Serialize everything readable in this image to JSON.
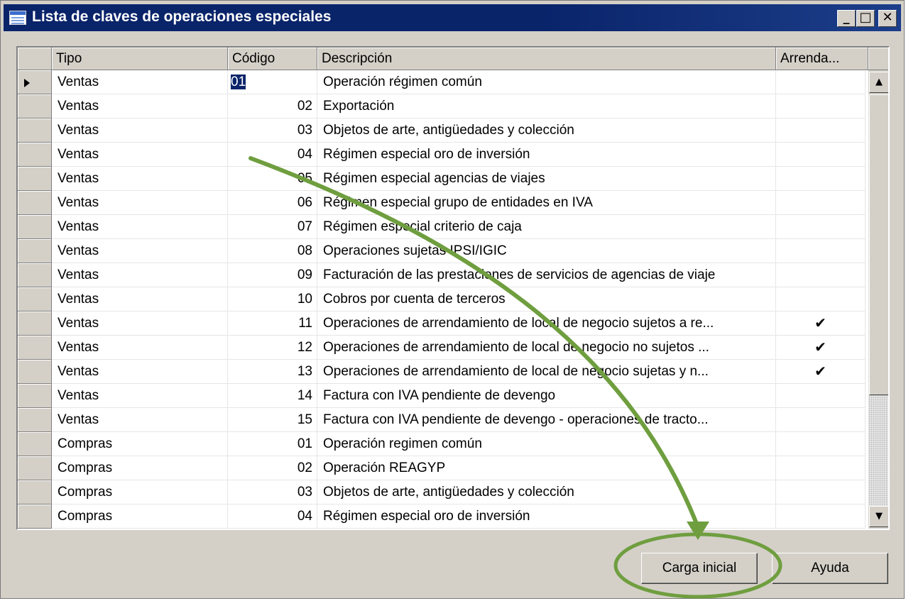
{
  "window": {
    "title": "Lista de claves de operaciones especiales",
    "controls": {
      "minimize": "_",
      "maximize": "□",
      "close": "✕"
    }
  },
  "grid": {
    "columns": [
      {
        "key": "tipo",
        "label": "Tipo"
      },
      {
        "key": "codigo",
        "label": "Código"
      },
      {
        "key": "descripcion",
        "label": "Descripción"
      },
      {
        "key": "arrendamiento",
        "label": "Arrenda..."
      }
    ],
    "rows": [
      {
        "tipo": "Ventas",
        "codigo": "01",
        "descripcion": "Operación régimen común",
        "arrendamiento": ""
      },
      {
        "tipo": "Ventas",
        "codigo": "02",
        "descripcion": "Exportación",
        "arrendamiento": ""
      },
      {
        "tipo": "Ventas",
        "codigo": "03",
        "descripcion": "Objetos de arte, antigüedades y colección",
        "arrendamiento": ""
      },
      {
        "tipo": "Ventas",
        "codigo": "04",
        "descripcion": "Régimen especial oro de inversión",
        "arrendamiento": ""
      },
      {
        "tipo": "Ventas",
        "codigo": "05",
        "descripcion": "Régimen especial agencias de viajes",
        "arrendamiento": ""
      },
      {
        "tipo": "Ventas",
        "codigo": "06",
        "descripcion": "Régimen especial grupo de entidades en IVA",
        "arrendamiento": ""
      },
      {
        "tipo": "Ventas",
        "codigo": "07",
        "descripcion": "Régimen especial criterio de caja",
        "arrendamiento": ""
      },
      {
        "tipo": "Ventas",
        "codigo": "08",
        "descripcion": "Operaciones sujetas IPSI/IGIC",
        "arrendamiento": ""
      },
      {
        "tipo": "Ventas",
        "codigo": "09",
        "descripcion": "Facturación de las prestaciones de servicios de agencias de viaje",
        "arrendamiento": ""
      },
      {
        "tipo": "Ventas",
        "codigo": "10",
        "descripcion": "Cobros por cuenta de terceros",
        "arrendamiento": ""
      },
      {
        "tipo": "Ventas",
        "codigo": "11",
        "descripcion": "Operaciones de arrendamiento de local de negocio sujetos a re...",
        "arrendamiento": "✔"
      },
      {
        "tipo": "Ventas",
        "codigo": "12",
        "descripcion": "Operaciones de arrendamiento de local de negocio no sujetos ...",
        "arrendamiento": "✔"
      },
      {
        "tipo": "Ventas",
        "codigo": "13",
        "descripcion": "Operaciones de arrendamiento de local de negocio sujetas y n...",
        "arrendamiento": "✔"
      },
      {
        "tipo": "Ventas",
        "codigo": "14",
        "descripcion": "Factura con IVA pendiente de devengo",
        "arrendamiento": ""
      },
      {
        "tipo": "Ventas",
        "codigo": "15",
        "descripcion": "Factura con IVA pendiente de devengo - operaciones de tracto...",
        "arrendamiento": ""
      },
      {
        "tipo": "Compras",
        "codigo": "01",
        "descripcion": "Operación regimen común",
        "arrendamiento": ""
      },
      {
        "tipo": "Compras",
        "codigo": "02",
        "descripcion": "Operación REAGYP",
        "arrendamiento": ""
      },
      {
        "tipo": "Compras",
        "codigo": "03",
        "descripcion": "Objetos de arte, antigüedades y colección",
        "arrendamiento": ""
      },
      {
        "tipo": "Compras",
        "codigo": "04",
        "descripcion": "Régimen especial oro de inversión",
        "arrendamiento": ""
      }
    ]
  },
  "scrollbar": {
    "up_icon": "▲",
    "down_icon": "▼"
  },
  "buttons": {
    "carga_inicial": "Carga inicial",
    "ayuda": "Ayuda"
  },
  "colors": {
    "titlebar": "#0a246a",
    "window_face": "#d4d0c8",
    "selection": "#0a246a",
    "annotation": "#6f9e3f"
  }
}
